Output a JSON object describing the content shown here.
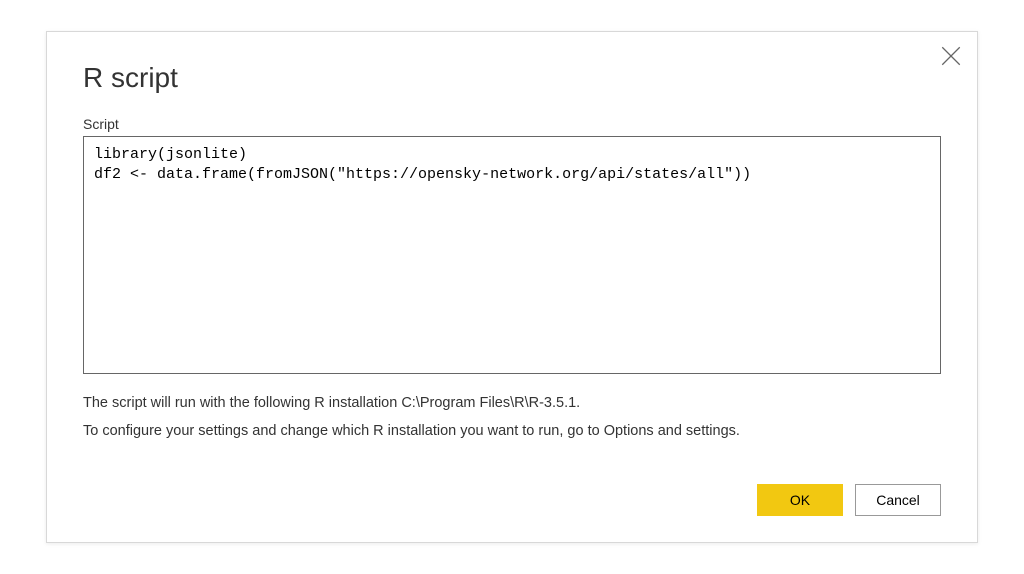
{
  "dialog": {
    "title": "R script",
    "script_label": "Script",
    "script_content": "library(jsonlite)\ndf2 <- data.frame(fromJSON(\"https://opensky-network.org/api/states/all\"))",
    "info_line1": "The script will run with the following R installation C:\\Program Files\\R\\R-3.5.1.",
    "info_line2": "To configure your settings and change which R installation you want to run, go to Options and settings.",
    "ok_label": "OK",
    "cancel_label": "Cancel"
  }
}
